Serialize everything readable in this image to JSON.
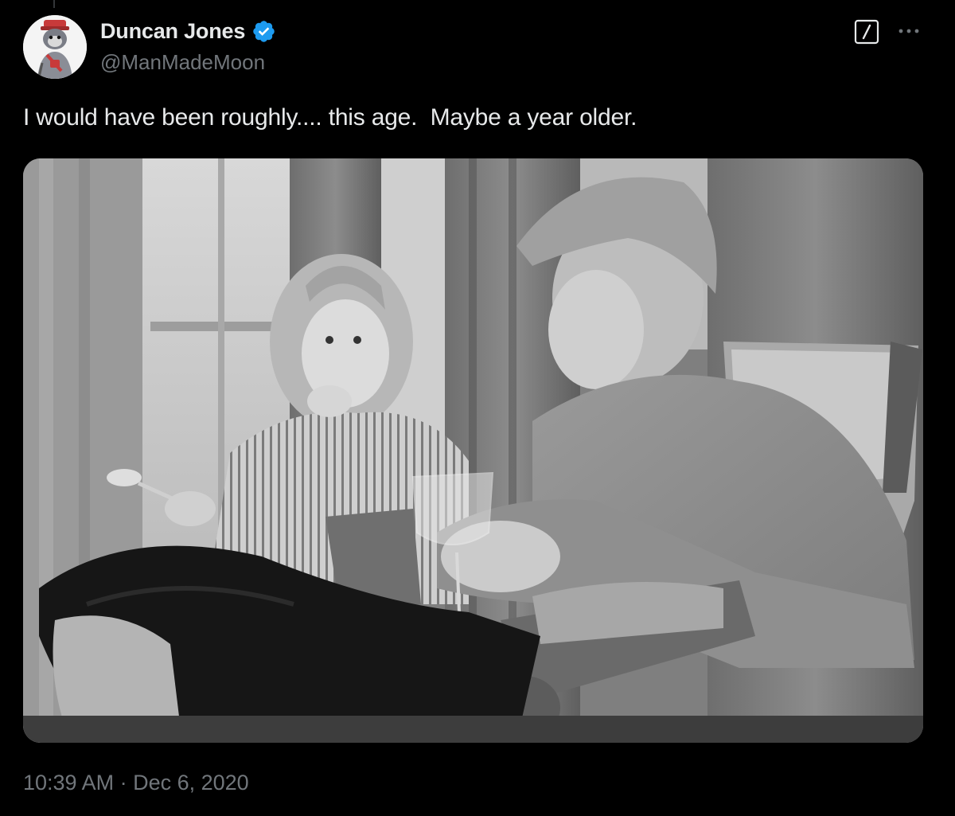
{
  "author": {
    "display_name": "Duncan Jones",
    "handle": "@ManMadeMoon",
    "avatar_icon": "avatar-image",
    "verified_icon": "verified-badge-icon",
    "verified_color": "#1d9bf0"
  },
  "tweet": {
    "text": "I would have been roughly.... this age.  Maybe a year older.",
    "timestamp": "10:39 AM · Dec 6, 2020"
  },
  "actions": {
    "grok_icon": "grok-icon",
    "more_icon": "more-options-icon"
  },
  "media": {
    "kind": "black-and-white photo",
    "icon": "photo-image"
  },
  "colors": {
    "background": "#000000",
    "primary_text": "#e7e9ea",
    "secondary_text": "#71767b",
    "accent": "#1d9bf0"
  }
}
